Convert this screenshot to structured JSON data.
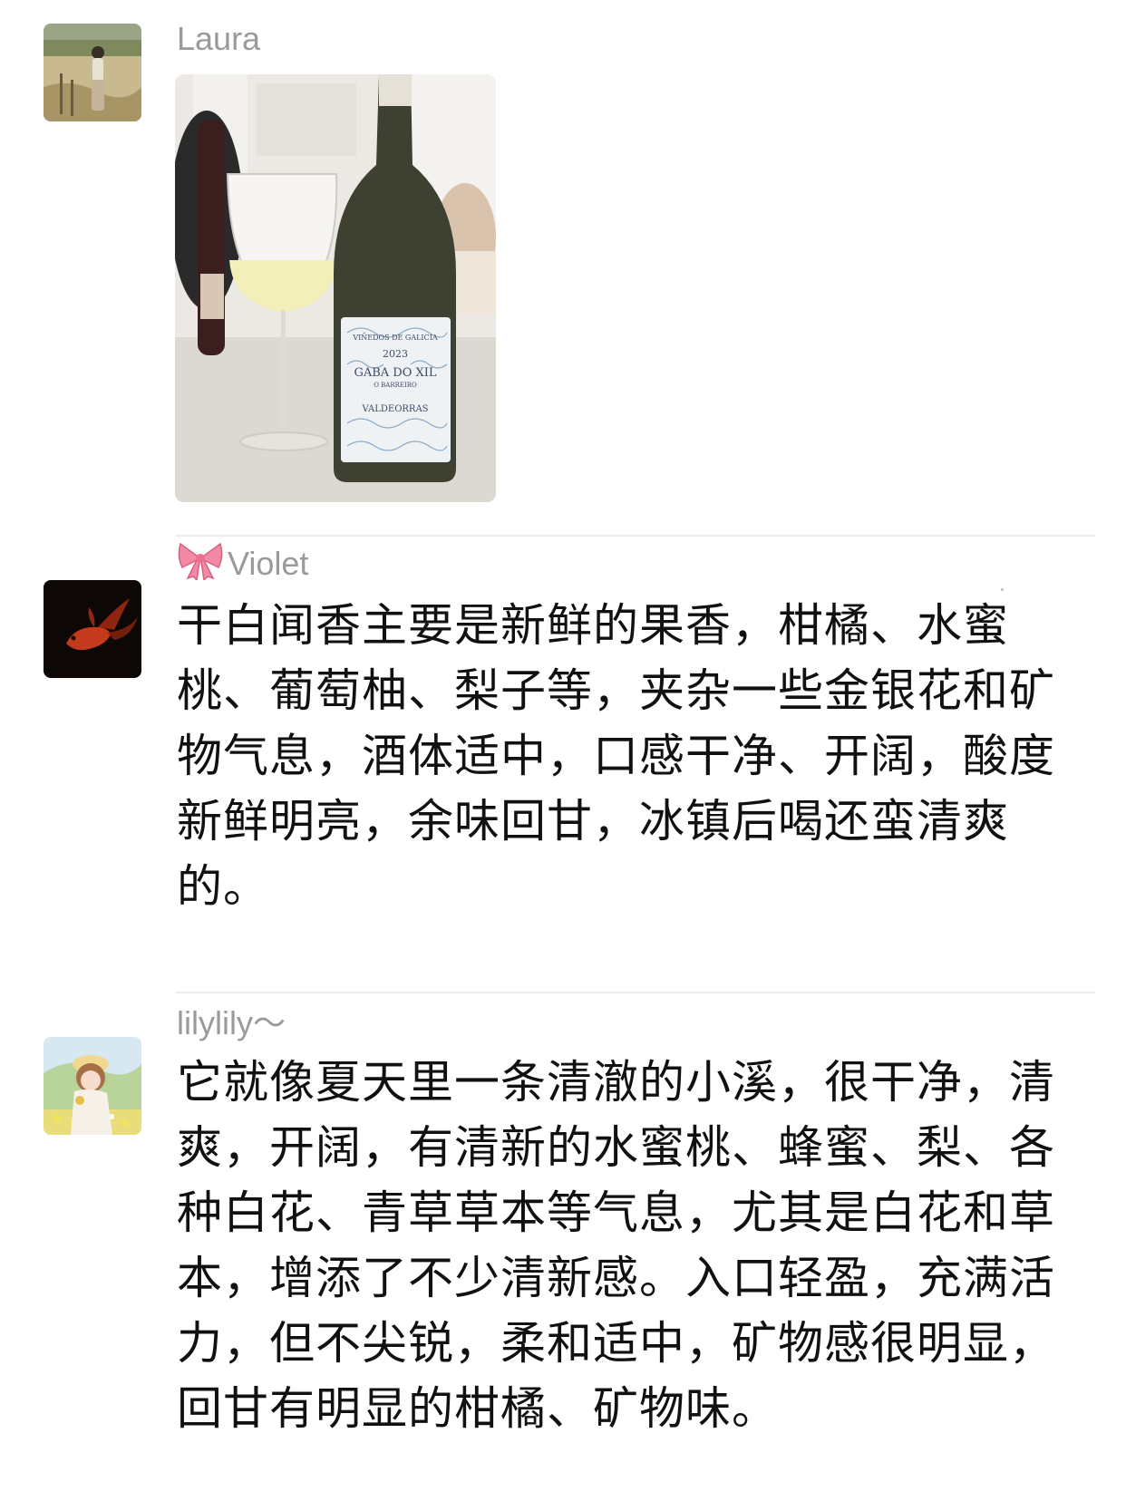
{
  "posts": [
    {
      "username": "Laura",
      "avatar_icon": "person-in-field-avatar",
      "photo": {
        "description_icon": "wine-bottle-and-glass-photo",
        "label_lines": [
          "VIÑEDOS DE GALICIA",
          "2023",
          "GABA DO XIL",
          "O BARREIRO",
          "VALDEORRAS"
        ]
      }
    },
    {
      "username": "Violet",
      "username_prefix_icon": "ribbon-bow-icon",
      "avatar_icon": "goldfish-avatar",
      "text": "干白闻香主要是新鲜的果香，柑橘、水蜜桃、葡萄柚、梨子等，夹杂一些金银花和矿物气息，酒体适中，口感干净、开阔，酸度新鲜明亮，余味回甘，冰镇后喝还蛮清爽的。"
    },
    {
      "username": "lilylily～",
      "avatar_icon": "illustrated-girl-avatar",
      "text": "它就像夏天里一条清澈的小溪，很干净，清爽，开阔，有清新的水蜜桃、蜂蜜、梨、各种白花、青草草本等气息，尤其是白花和草本，增添了不少清新感。入口轻盈，充满活力，但不尖锐，柔和适中，矿物感很明显，回甘有明显的柑橘、矿物味。"
    }
  ],
  "colors": {
    "username": "#9a9a9a",
    "text": "#111111",
    "divider": "#ececec",
    "background": "#ffffff"
  }
}
